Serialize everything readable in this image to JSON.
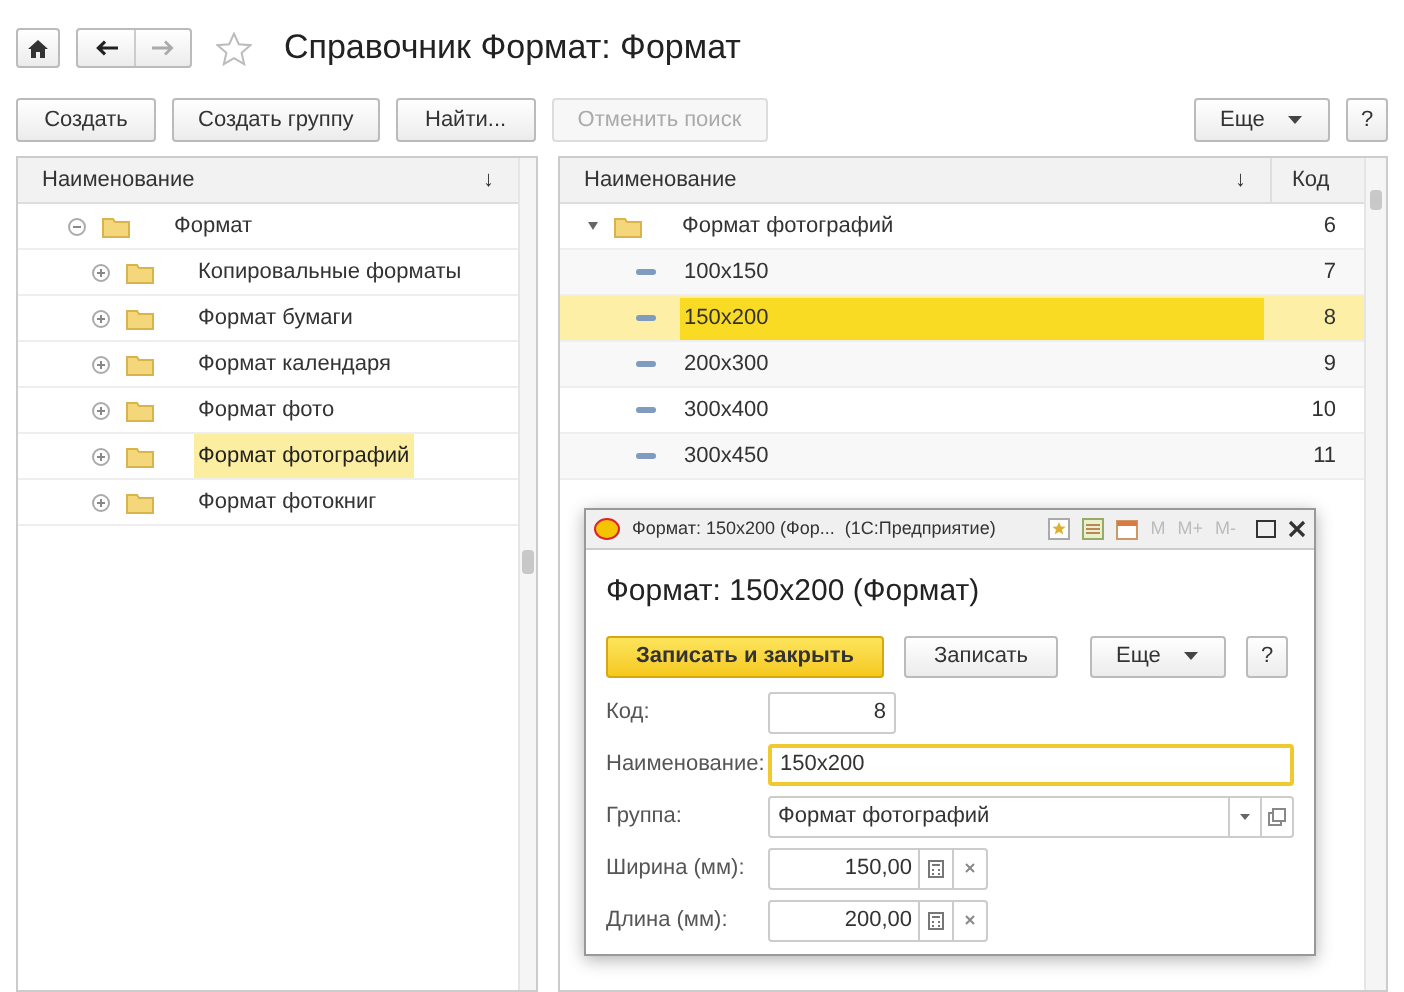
{
  "header": {
    "title": "Справочник Формат: Формат"
  },
  "toolbar": {
    "buttons": [
      {
        "label": "Создать",
        "disabled": false
      },
      {
        "label": "Создать группу",
        "disabled": false
      },
      {
        "label": "Найти...",
        "disabled": false
      },
      {
        "label": "Отменить поиск",
        "disabled": true
      }
    ],
    "more": "Еще",
    "help": "?"
  },
  "tree": {
    "column": "Наименование",
    "sort": "↓",
    "items": [
      {
        "label": "Формат",
        "expanded": true,
        "selected": false,
        "children": [
          {
            "label": "Копировальные форматы",
            "expanded": false,
            "selected": false
          },
          {
            "label": "Формат бумаги",
            "expanded": false,
            "selected": false
          },
          {
            "label": "Формат календаря",
            "expanded": false,
            "selected": false
          },
          {
            "label": "Формат фото",
            "expanded": false,
            "selected": false
          },
          {
            "label": "Формат фотографий",
            "expanded": false,
            "selected": true
          },
          {
            "label": "Формат фотокниг",
            "expanded": false,
            "selected": false
          }
        ]
      }
    ]
  },
  "list": {
    "columns": [
      "Наименование",
      "Код"
    ],
    "sort": "↓",
    "rows": [
      {
        "kind": "group",
        "name": "Формат фотографий",
        "code": "6",
        "selected": false
      },
      {
        "kind": "item",
        "name": "100x150",
        "code": "7",
        "selected": false
      },
      {
        "kind": "item",
        "name": "150x200",
        "code": "8",
        "selected": true
      },
      {
        "kind": "item",
        "name": "200x300",
        "code": "9",
        "selected": false
      },
      {
        "kind": "item",
        "name": "300x400",
        "code": "10",
        "selected": false
      },
      {
        "kind": "item",
        "name": "300x450",
        "code": "11",
        "selected": false
      }
    ]
  },
  "dialog": {
    "window_title": "Формат: 150x200 (Фор...  (1С:Предприятие)",
    "memory_buttons": [
      "M",
      "M+",
      "M-"
    ],
    "heading": "Формат: 150x200 (Формат)",
    "buttons": [
      {
        "label": "Записать и закрыть",
        "default": true
      },
      {
        "label": "Записать",
        "default": false
      }
    ],
    "more": "Еще",
    "help": "?",
    "fields": [
      {
        "kind": "number",
        "label": "Код:",
        "value": "8",
        "focused": false
      },
      {
        "kind": "text",
        "label": "Наименование:",
        "value": "150x200",
        "focused": true
      },
      {
        "kind": "select",
        "label": "Группа:",
        "value": "Формат фотографий",
        "focused": false
      },
      {
        "kind": "calc",
        "label": "Ширина (мм):",
        "value": "150,00",
        "focused": false
      },
      {
        "kind": "calc",
        "label": "Длина (мм):",
        "value": "200,00",
        "focused": false
      }
    ]
  }
}
